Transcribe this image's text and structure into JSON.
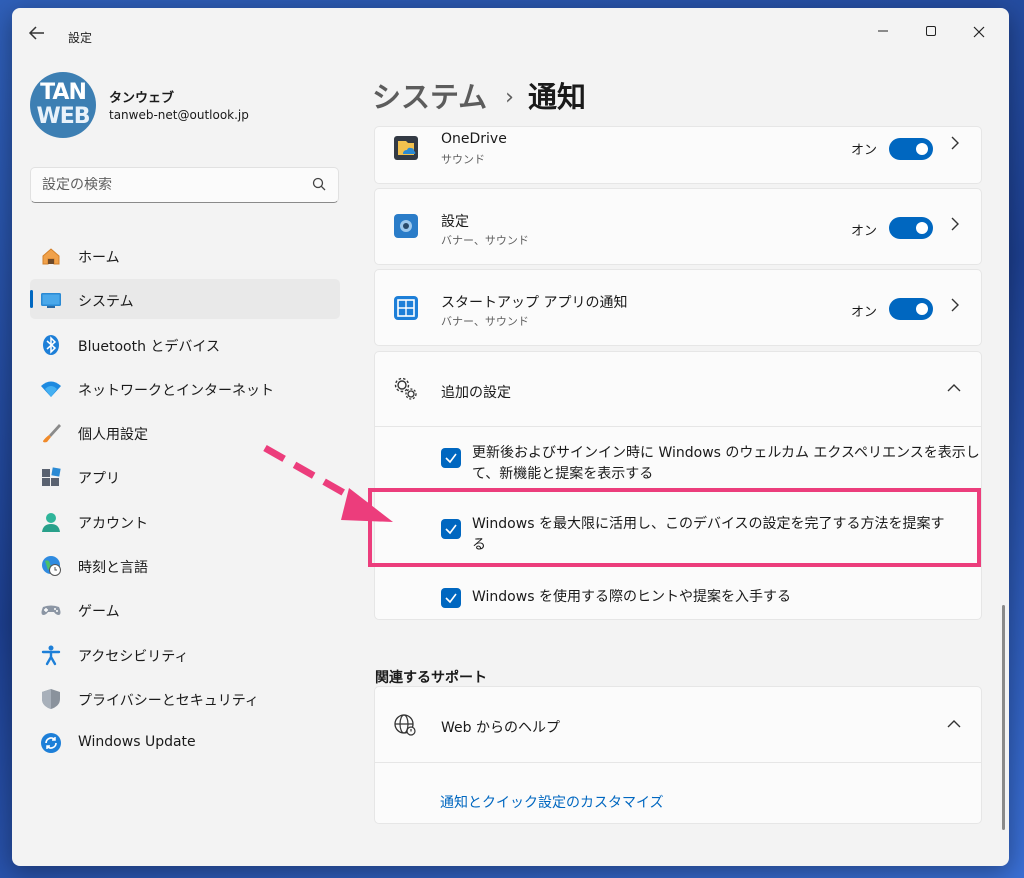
{
  "window": {
    "title": "設定"
  },
  "user": {
    "avatar_line1": "TAN",
    "avatar_line2": "WEB",
    "name": "タンウェブ",
    "email": "tanweb-net@outlook.jp"
  },
  "search": {
    "placeholder": "設定の検索"
  },
  "sidebar": {
    "items": [
      {
        "label": "ホーム",
        "icon": "home-icon"
      },
      {
        "label": "システム",
        "icon": "system-icon",
        "active": true
      },
      {
        "label": "Bluetooth とデバイス",
        "icon": "bluetooth-icon"
      },
      {
        "label": "ネットワークとインターネット",
        "icon": "wifi-icon"
      },
      {
        "label": "個人用設定",
        "icon": "brush-icon"
      },
      {
        "label": "アプリ",
        "icon": "apps-icon"
      },
      {
        "label": "アカウント",
        "icon": "account-icon"
      },
      {
        "label": "時刻と言語",
        "icon": "time-language-icon"
      },
      {
        "label": "ゲーム",
        "icon": "gamepad-icon"
      },
      {
        "label": "アクセシビリティ",
        "icon": "accessibility-icon"
      },
      {
        "label": "プライバシーとセキュリティ",
        "icon": "shield-icon"
      },
      {
        "label": "Windows Update",
        "icon": "update-icon"
      }
    ]
  },
  "breadcrumb": {
    "parent": "システム",
    "separator": "›",
    "current": "通知"
  },
  "apps": [
    {
      "name": "OneDrive",
      "sub": "サウンド",
      "state": "オン",
      "toggle_on": true
    },
    {
      "name": "設定",
      "sub": "バナー、サウンド",
      "state": "オン",
      "toggle_on": true
    },
    {
      "name": "スタートアップ アプリの通知",
      "sub": "バナー、サウンド",
      "state": "オン",
      "toggle_on": true
    }
  ],
  "additional": {
    "title": "追加の設定",
    "options": [
      {
        "line1": "更新後およびサインイン時に Windows のウェルカム エクスペリエンスを表示し",
        "line2": "て、新機能と提案を表示する",
        "checked": true
      },
      {
        "line1": "Windows を最大限に活用し、このデバイスの設定を完了する方法を提案す",
        "line2": "る",
        "checked": true
      },
      {
        "line1": "Windows を使用する際のヒントや提案を入手する",
        "line2": "",
        "checked": true
      }
    ]
  },
  "support": {
    "section_label": "関連するサポート",
    "help_title": "Web からのヘルプ",
    "link": "通知とクイック設定のカスタマイズ"
  },
  "colors": {
    "accent": "#0067c0",
    "highlight": "#ec3d7c"
  }
}
